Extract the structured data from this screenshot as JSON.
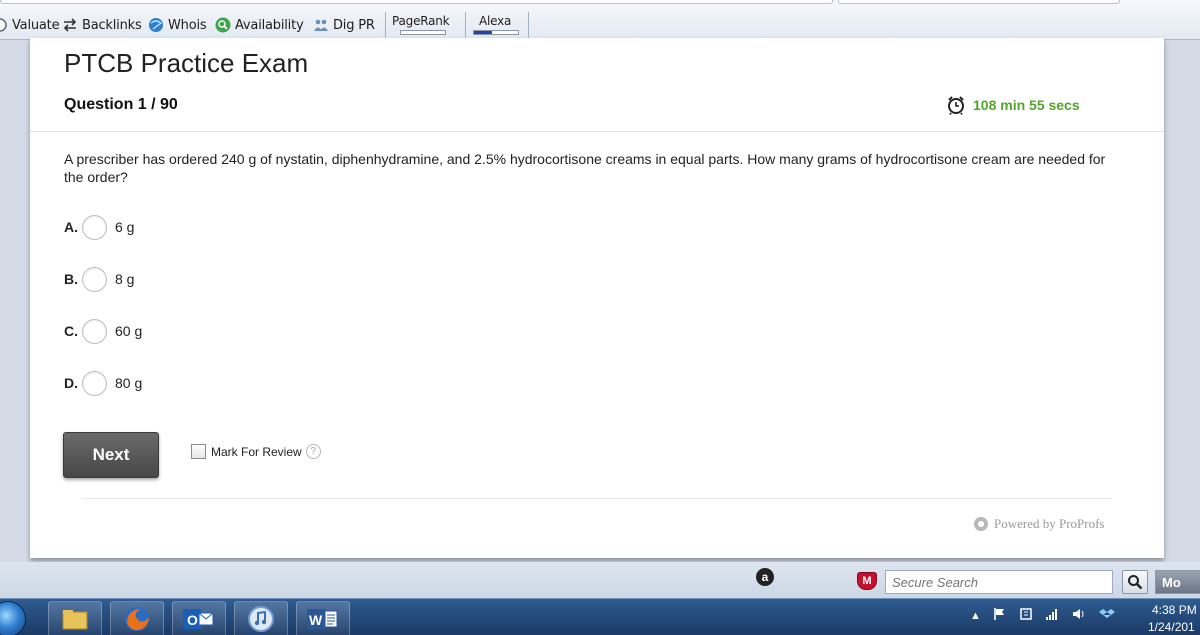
{
  "toolbar": {
    "items": [
      {
        "label": "Valuate",
        "icon": "circle-icon"
      },
      {
        "label": "Backlinks",
        "icon": "swap-arrows-icon"
      },
      {
        "label": "Whois",
        "icon": "globe-icon"
      },
      {
        "label": "Availability",
        "icon": "magnifier-icon"
      },
      {
        "label": "Dig PR",
        "icon": "people-icon"
      }
    ],
    "pagerank_label": "PageRank",
    "pagerank_level": 0,
    "alexa_label": "Alexa",
    "alexa_level": 0.4
  },
  "exam": {
    "title": "PTCB Practice Exam",
    "question_counter": "Question 1 / 90",
    "timer": "108 min 55 secs",
    "timer_color": "#54a32d",
    "question_text": "A prescriber has ordered 240 g of nystatin, diphenhydramine, and 2.5% hydrocortisone creams in equal parts. How many grams of hydrocortisone cream are needed for the order?",
    "options": [
      {
        "letter": "A.",
        "text": "6 g"
      },
      {
        "letter": "B.",
        "text": "8 g"
      },
      {
        "letter": "C.",
        "text": "60 g"
      },
      {
        "letter": "D.",
        "text": "80 g"
      }
    ],
    "next_label": "Next",
    "mark_review_label": "Mark For Review",
    "help_glyph": "?",
    "powered_by": "Powered by ProProfs"
  },
  "lower_bar": {
    "amazon_glyph": "a",
    "mcafee_glyph": "M",
    "search_placeholder": "Secure Search",
    "more_label": "Mo"
  },
  "taskbar": {
    "time": "4:38 PM",
    "date": "1/24/201"
  }
}
